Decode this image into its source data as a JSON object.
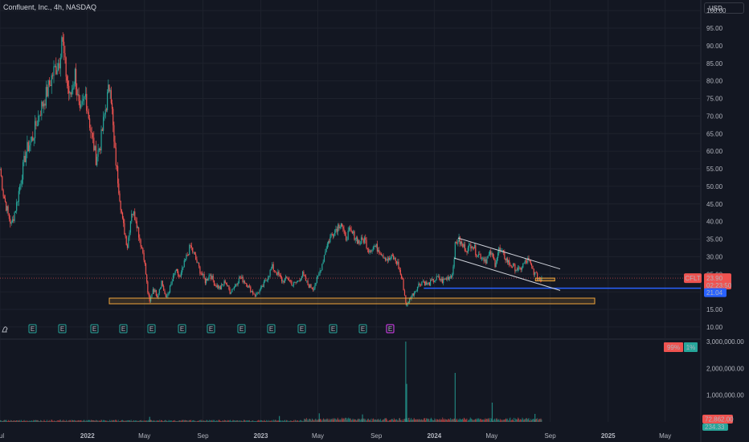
{
  "header": {
    "title": "Confluent, Inc., 4h, NASDAQ"
  },
  "toolbar": {
    "currency": "USD"
  },
  "colors": {
    "background": "#131722",
    "grid": "#1e222d",
    "up": "#26a69a",
    "down": "#ef5350",
    "trendline": "#d1d4dc",
    "support_zone": "#f0a53a",
    "support_line": "#2962ff",
    "volume_up": "#26a69a",
    "volume_down": "#ef5350"
  },
  "badges": {
    "ticker": "CFLT",
    "price": "23.90",
    "countdown": "02:23:50",
    "support_price": "21.04",
    "volume_value": "72,862.00",
    "volume_value2": "234.33",
    "sentiment_sell": "99%",
    "sentiment_buy": "1%"
  },
  "events": {
    "earnings": [
      "E",
      "E",
      "E",
      "E",
      "E",
      "E",
      "E",
      "E",
      "E",
      "E",
      "E",
      "E",
      "E"
    ],
    "upcoming": "E"
  },
  "chart_data": [
    {
      "type": "candlestick",
      "title": "Confluent, Inc., 4h, NASDAQ",
      "currency": "USD",
      "x_ticks": [
        "Jul",
        "2022",
        "May",
        "Sep",
        "2023",
        "May",
        "Sep",
        "2024",
        "May",
        "Sep",
        "2025",
        "May"
      ],
      "y_ticks": [
        "10.00",
        "15.00",
        "20.00",
        "25.00",
        "30.00",
        "35.00",
        "40.00",
        "45.00",
        "50.00",
        "55.00",
        "60.00",
        "65.00",
        "70.00",
        "75.00",
        "80.00",
        "85.00",
        "90.00",
        "95.00",
        "100.00"
      ],
      "ylim": [
        7,
        103
      ],
      "x_range": [
        "2021-07-01",
        "2025-07-15"
      ],
      "close_series": [
        [
          "2021-07-01",
          55
        ],
        [
          "2021-07-08",
          48
        ],
        [
          "2021-07-18",
          42
        ],
        [
          "2021-07-25",
          39
        ],
        [
          "2021-08-05",
          45
        ],
        [
          "2021-08-14",
          52
        ],
        [
          "2021-08-25",
          60
        ],
        [
          "2021-09-08",
          64
        ],
        [
          "2021-09-22",
          71
        ],
        [
          "2021-10-06",
          76
        ],
        [
          "2021-10-20",
          82
        ],
        [
          "2021-11-03",
          86
        ],
        [
          "2021-11-08",
          93
        ],
        [
          "2021-11-15",
          84
        ],
        [
          "2021-11-25",
          75
        ],
        [
          "2021-12-06",
          82
        ],
        [
          "2021-12-16",
          70
        ],
        [
          "2021-12-28",
          76
        ],
        [
          "2022-01-08",
          66
        ],
        [
          "2022-01-19",
          58
        ],
        [
          "2022-01-28",
          62
        ],
        [
          "2022-02-08",
          72
        ],
        [
          "2022-02-18",
          80
        ],
        [
          "2022-02-26",
          62
        ],
        [
          "2022-03-06",
          52
        ],
        [
          "2022-03-16",
          40
        ],
        [
          "2022-03-26",
          33
        ],
        [
          "2022-04-04",
          43
        ],
        [
          "2022-04-13",
          41
        ],
        [
          "2022-04-21",
          35
        ],
        [
          "2022-04-30",
          30
        ],
        [
          "2022-05-08",
          20
        ],
        [
          "2022-05-12",
          17
        ],
        [
          "2022-05-19",
          21
        ],
        [
          "2022-05-28",
          19
        ],
        [
          "2022-06-06",
          23
        ],
        [
          "2022-06-15",
          18
        ],
        [
          "2022-06-26",
          22
        ],
        [
          "2022-07-05",
          26
        ],
        [
          "2022-07-15",
          24
        ],
        [
          "2022-07-26",
          29
        ],
        [
          "2022-08-06",
          33
        ],
        [
          "2022-08-15",
          30
        ],
        [
          "2022-08-26",
          26
        ],
        [
          "2022-09-06",
          23
        ],
        [
          "2022-09-16",
          25
        ],
        [
          "2022-09-27",
          22
        ],
        [
          "2022-10-08",
          21
        ],
        [
          "2022-10-18",
          23
        ],
        [
          "2022-10-28",
          20
        ],
        [
          "2022-11-08",
          22
        ],
        [
          "2022-11-18",
          24
        ],
        [
          "2022-11-28",
          23
        ],
        [
          "2022-12-08",
          21
        ],
        [
          "2022-12-20",
          19
        ],
        [
          "2023-01-03",
          21
        ],
        [
          "2023-01-14",
          24
        ],
        [
          "2023-01-25",
          27
        ],
        [
          "2023-02-06",
          25
        ],
        [
          "2023-02-16",
          23
        ],
        [
          "2023-02-27",
          24
        ],
        [
          "2023-03-09",
          22
        ],
        [
          "2023-03-20",
          23
        ],
        [
          "2023-03-30",
          25
        ],
        [
          "2023-04-10",
          22
        ],
        [
          "2023-04-21",
          21
        ],
        [
          "2023-05-01",
          24
        ],
        [
          "2023-05-10",
          28
        ],
        [
          "2023-05-19",
          33
        ],
        [
          "2023-05-29",
          36
        ],
        [
          "2023-06-08",
          38
        ],
        [
          "2023-06-19",
          40
        ],
        [
          "2023-06-27",
          35
        ],
        [
          "2023-07-06",
          37
        ],
        [
          "2023-07-17",
          36
        ],
        [
          "2023-07-27",
          34
        ],
        [
          "2023-08-07",
          35
        ],
        [
          "2023-08-16",
          32
        ],
        [
          "2023-08-28",
          33
        ],
        [
          "2023-09-07",
          32
        ],
        [
          "2023-09-18",
          30
        ],
        [
          "2023-09-27",
          29
        ],
        [
          "2023-10-05",
          30
        ],
        [
          "2023-10-16",
          28
        ],
        [
          "2023-10-26",
          23
        ],
        [
          "2023-11-02",
          17
        ],
        [
          "2023-11-04",
          16
        ],
        [
          "2023-11-10",
          18
        ],
        [
          "2023-11-20",
          20
        ],
        [
          "2023-11-29",
          22
        ],
        [
          "2023-12-08",
          23
        ],
        [
          "2023-12-18",
          22
        ],
        [
          "2023-12-28",
          23
        ],
        [
          "2024-01-08",
          24
        ],
        [
          "2024-01-18",
          23
        ],
        [
          "2024-01-29",
          24
        ],
        [
          "2024-02-08",
          25
        ],
        [
          "2024-02-14",
          33
        ],
        [
          "2024-02-20",
          35
        ],
        [
          "2024-03-01",
          33
        ],
        [
          "2024-03-12",
          32
        ],
        [
          "2024-03-20",
          34
        ],
        [
          "2024-03-30",
          31
        ],
        [
          "2024-04-10",
          30
        ],
        [
          "2024-04-19",
          29
        ],
        [
          "2024-04-29",
          31
        ],
        [
          "2024-05-08",
          28
        ],
        [
          "2024-05-16",
          32
        ],
        [
          "2024-05-28",
          30
        ],
        [
          "2024-06-07",
          28
        ],
        [
          "2024-06-17",
          27
        ],
        [
          "2024-06-27",
          26
        ],
        [
          "2024-07-08",
          28
        ],
        [
          "2024-07-16",
          29
        ],
        [
          "2024-07-24",
          27
        ],
        [
          "2024-07-31",
          25
        ],
        [
          "2024-08-05",
          24
        ],
        [
          "2024-08-12",
          23.5
        ],
        [
          "2024-08-14",
          23.9
        ]
      ],
      "annotations": {
        "current_price": 23.9,
        "support_line": 21.04,
        "support_zone": [
          16.6,
          18.2
        ],
        "channel_upper": [
          [
            "2024-02-20",
            35.3
          ],
          [
            "2024-09-22",
            26.5
          ]
        ],
        "channel_lower": [
          [
            "2024-02-12",
            29.6
          ],
          [
            "2024-09-22",
            20.4
          ]
        ],
        "target_box": [
          23.1,
          23.9
        ]
      }
    },
    {
      "type": "bar",
      "series_role": "volume",
      "y_ticks": [
        "1,000,000.00",
        "2,000,000.00",
        "3,000,000.00"
      ],
      "ylim": [
        0,
        3000000
      ],
      "spikes": [
        [
          "2022-05-12",
          190000
        ],
        [
          "2023-02-09",
          220000
        ],
        [
          "2023-05-04",
          320000
        ],
        [
          "2023-08-03",
          280000
        ],
        [
          "2023-11-02",
          3000000
        ],
        [
          "2023-11-04",
          1420000
        ],
        [
          "2024-02-14",
          1830000
        ],
        [
          "2024-05-02",
          720000
        ],
        [
          "2024-07-31",
          300000
        ]
      ]
    }
  ]
}
